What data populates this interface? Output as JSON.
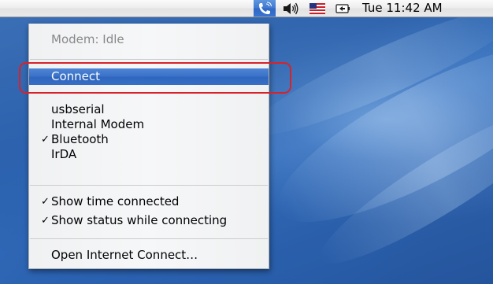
{
  "menubar": {
    "extras": [
      {
        "icon": "phone-modem-icon",
        "selected": true
      },
      {
        "icon": "volume-icon",
        "selected": false
      },
      {
        "icon": "us-flag-icon",
        "selected": false
      },
      {
        "icon": "battery-icon",
        "selected": false
      }
    ],
    "clock": "Tue 11:42 AM"
  },
  "menu": {
    "status": "Modem: Idle",
    "connect": "Connect",
    "ports": [
      {
        "label": "usbserial",
        "checked": false
      },
      {
        "label": "Internal Modem",
        "checked": false
      },
      {
        "label": "Bluetooth",
        "checked": true
      },
      {
        "label": "IrDA",
        "checked": false
      }
    ],
    "options": [
      {
        "label": "Show time connected",
        "checked": true
      },
      {
        "label": "Show status while connecting",
        "checked": true
      }
    ],
    "open_internet_connect": "Open Internet Connect…"
  },
  "colors": {
    "highlight": "#3a72c8",
    "annotation_ring": "#d8222a",
    "desktop": "#2f64ad"
  }
}
